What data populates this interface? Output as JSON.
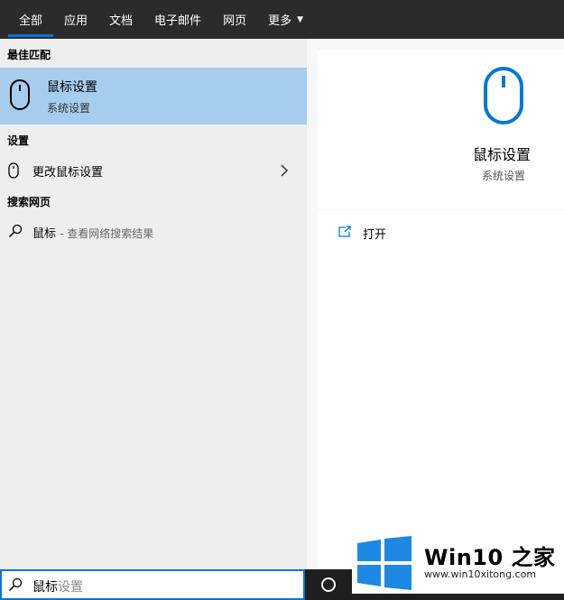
{
  "tabs": [
    {
      "label": "全部",
      "active": true
    },
    {
      "label": "应用"
    },
    {
      "label": "文档"
    },
    {
      "label": "电子邮件"
    },
    {
      "label": "网页"
    },
    {
      "label": "更多"
    }
  ],
  "left": {
    "best_match_heading": "最佳匹配",
    "best_match": {
      "title": "鼠标设置",
      "subtitle": "系统设置",
      "icon": "mouse-icon"
    },
    "settings_heading": "设置",
    "settings_item": {
      "label": "更改鼠标设置",
      "icon": "mouse-icon"
    },
    "web_heading": "搜索网页",
    "web_item": {
      "label": "鼠标",
      "suffix": "- 查看网络搜索结果",
      "icon": "search-icon"
    }
  },
  "right": {
    "title": "鼠标设置",
    "subtitle": "系统设置",
    "open_label": "打开"
  },
  "search": {
    "typed": "鼠标",
    "ghost": "设置"
  },
  "watermark": {
    "brand": "Win10 之家",
    "url": "www.win10xitong.com"
  },
  "colors": {
    "accent": "#0078d7",
    "selected": "#a7cdee",
    "topbar": "#2b2b2b"
  }
}
